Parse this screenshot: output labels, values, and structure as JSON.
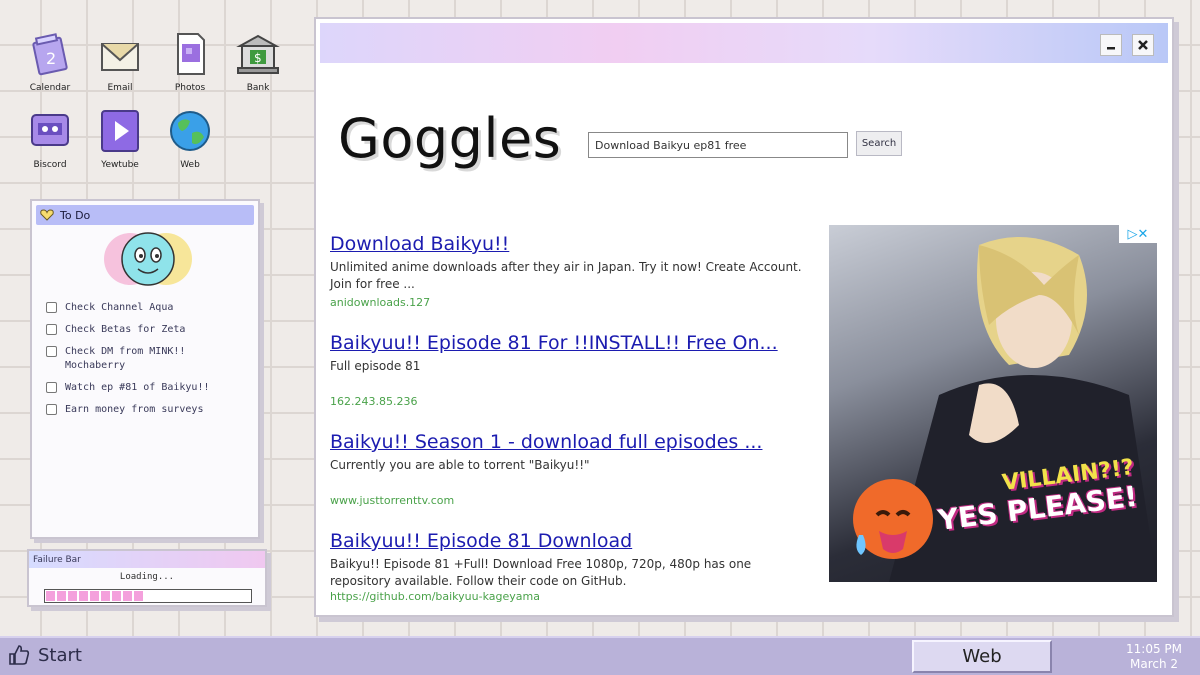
{
  "desktop": {
    "icons": [
      {
        "label": "Calendar",
        "icon": "calendar-icon"
      },
      {
        "label": "Email",
        "icon": "envelope-icon"
      },
      {
        "label": "Photos",
        "icon": "photo-icon"
      },
      {
        "label": "Bank",
        "icon": "bank-icon"
      },
      {
        "label": "Biscord",
        "icon": "chat-app-icon"
      },
      {
        "label": "Yewtube",
        "icon": "play-icon"
      },
      {
        "label": "Web",
        "icon": "globe-icon"
      }
    ]
  },
  "todo": {
    "title": "To Do",
    "items": [
      {
        "text": "Check Channel Aqua",
        "checked": false
      },
      {
        "text": "Check Betas for Zeta",
        "checked": false
      },
      {
        "text": "Check DM from MINK!! Mochaberry",
        "checked": false
      },
      {
        "text": "Watch ep #81 of Baikyu!!",
        "checked": false
      },
      {
        "text": "Earn money from surveys",
        "checked": false
      }
    ]
  },
  "failure_bar": {
    "title": "Failure Bar",
    "status": "Loading...",
    "progress": 0.48
  },
  "browser": {
    "logo": "Goggles",
    "search": {
      "value": "Download Baikyu ep81 free",
      "button_label": "Search"
    },
    "results": [
      {
        "title": "Download Baikyu!!",
        "description": "Unlimited anime downloads after they air in Japan. Try it now! Create Account. Join for free ...",
        "url": "anidownloads.127"
      },
      {
        "title": "Baikyuu!! Episode 81 For !!INSTALL!! Free On...",
        "description": "Full episode 81",
        "url": "162.243.85.236"
      },
      {
        "title": "Baikyu!! Season 1 - download full episodes  ...",
        "description": "Currently you are able to torrent \"Baikyu!!\"",
        "url": "www.justtorrenttv.com"
      },
      {
        "title": "Baikyuu!! Episode 81 Download",
        "description": "Baikyu!! Episode 81 +Full! Download Free 1080p, 720p, 480p has one repository available. Follow their code on GitHub.",
        "url": "https://github.com/baikyuu-kageyama"
      }
    ],
    "ad": {
      "badge": "▷✕",
      "line1": "VILLAIN?!?",
      "line2": "YES PLEASE!"
    }
  },
  "taskbar": {
    "start_label": "Start",
    "active_window": "Web",
    "time": "11:05 PM",
    "date": "March 2"
  },
  "colors": {
    "link": "#1c1cb0",
    "url_green": "#4aa24a",
    "taskbar": "#b9b2d9",
    "progress_pink": "#f4a0dc"
  }
}
